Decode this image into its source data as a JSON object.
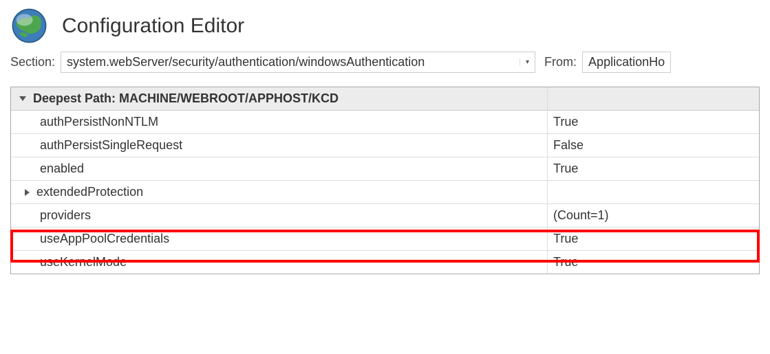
{
  "header": {
    "title": "Configuration Editor"
  },
  "section": {
    "label": "Section:",
    "value": "system.webServer/security/authentication/windowsAuthentication",
    "fromLabel": "From:",
    "fromValue": "ApplicationHo"
  },
  "grid": {
    "deepestPathLabel": "Deepest Path: ",
    "deepestPathValue": "MACHINE/WEBROOT/APPHOST/KCD",
    "rows": [
      {
        "name": "authPersistNonNTLM",
        "value": "True",
        "expandable": false
      },
      {
        "name": "authPersistSingleRequest",
        "value": "False",
        "expandable": false
      },
      {
        "name": "enabled",
        "value": "True",
        "expandable": false
      },
      {
        "name": "extendedProtection",
        "value": "",
        "expandable": true
      },
      {
        "name": "providers",
        "value": "(Count=1)",
        "expandable": false
      },
      {
        "name": "useAppPoolCredentials",
        "value": "True",
        "expandable": false
      },
      {
        "name": "useKernelMode",
        "value": "True",
        "expandable": false
      }
    ]
  }
}
